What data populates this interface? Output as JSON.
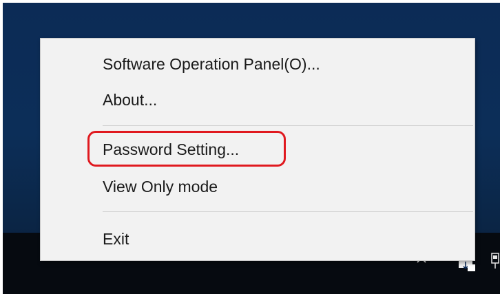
{
  "menu": {
    "items": [
      {
        "label": "Software Operation Panel(O)..."
      },
      {
        "label": "About..."
      },
      {
        "label": "Password Setting..."
      },
      {
        "label": "View Only mode"
      },
      {
        "label": "Exit"
      }
    ]
  },
  "tray": {
    "icons": [
      "chevron-up-icon",
      "scanner-icon",
      "network-icon"
    ]
  },
  "colors": {
    "desktop": "#0c2b56",
    "taskbar": "#060a10",
    "menu_bg": "#f2f2f2",
    "highlight": "#e0191f"
  }
}
